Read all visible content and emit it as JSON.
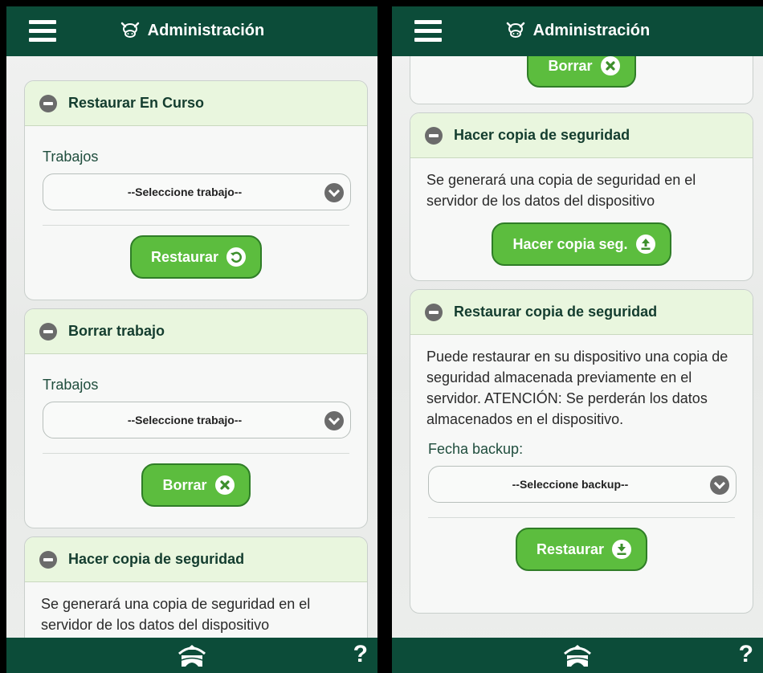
{
  "header": {
    "title": "Administración"
  },
  "left": {
    "restore_in_progress": {
      "title": "Restaurar En Curso",
      "field_label": "Trabajos",
      "select_value": "--Seleccione trabajo--",
      "button_label": "Restaurar"
    },
    "delete_job": {
      "title": "Borrar trabajo",
      "field_label": "Trabajos",
      "select_value": "--Seleccione trabajo--",
      "button_label": "Borrar"
    },
    "backup": {
      "title": "Hacer copia de seguridad",
      "description": "Se generará una copia de seguridad en el servidor de los datos del dispositivo"
    }
  },
  "right": {
    "delete_button_label": "Borrar",
    "backup": {
      "title": "Hacer copia de seguridad",
      "description": "Se generará una copia de seguridad en el servidor de los datos del dispositivo",
      "button_label": "Hacer copia seg."
    },
    "restore_backup": {
      "title": "Restaurar copia de seguridad",
      "description": "Puede restaurar en su dispositivo una copia de seguridad almacenada previamente en el servidor. ATENCIÓN: Se perderán los datos almacenados en el dispositivo.",
      "field_label": "Fecha backup:",
      "select_value": "--Seleccione backup--",
      "button_label": "Restaurar"
    }
  },
  "footer": {
    "help": "?"
  },
  "icons": {
    "menu": "hamburger-icon",
    "logo": "cow-icon",
    "collapse": "minus-circle-icon",
    "dropdown": "chevron-down-icon",
    "restore": "refresh-icon",
    "delete": "close-circle-icon",
    "upload": "upload-icon",
    "download": "download-icon",
    "home": "shelter-logo-icon"
  },
  "colors": {
    "bar": "#0c4c39",
    "button": "#5cbd3e",
    "card_header": "#e9f6de"
  }
}
